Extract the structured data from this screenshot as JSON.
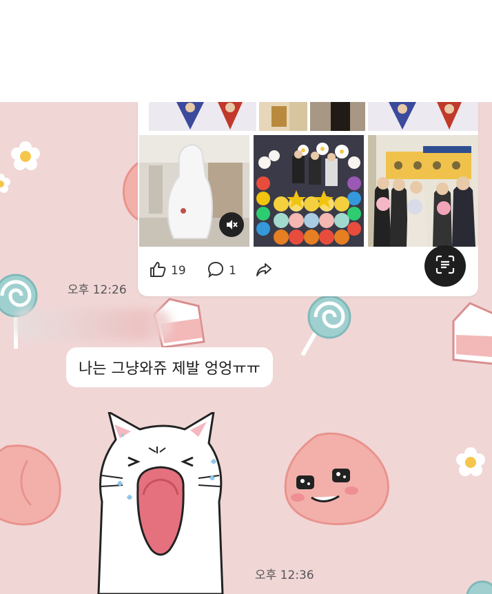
{
  "post": {
    "likes": "19",
    "comments": "1"
  },
  "messages": [
    {
      "time": "오후 12:26"
    },
    {
      "text": "나는 그냥와쥬 제발 엉엉ㅠㅠ"
    },
    {
      "time": "오후 12:36"
    }
  ],
  "icons": {
    "like": "thumbs-up-icon",
    "comment": "comment-bubble-icon",
    "share": "share-arrow-icon",
    "lens": "scan-lens-icon",
    "mute": "mute-icon"
  },
  "colors": {
    "chat_background": "#f1d6d6",
    "bubble": "#ffffff",
    "lens_button": "#1e1e1e"
  }
}
